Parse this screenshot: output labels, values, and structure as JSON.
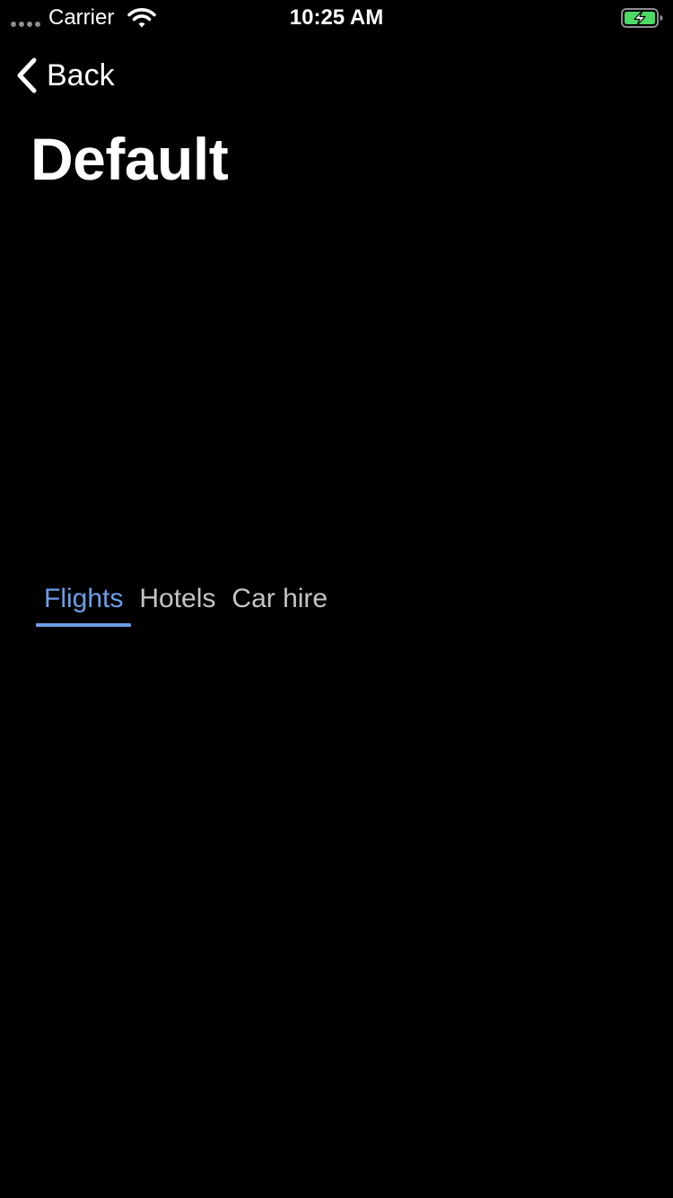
{
  "status_bar": {
    "carrier": "Carrier",
    "time": "10:25 AM",
    "signal_icon": "signal-dots-icon",
    "wifi_icon": "wifi-icon",
    "battery_icon": "battery-charging-icon",
    "battery_color": "#4cd964"
  },
  "nav": {
    "back_label": "Back",
    "back_icon": "chevron-left-icon"
  },
  "page": {
    "title": "Default"
  },
  "tabs": {
    "accent_color": "#6d9ee8",
    "inactive_color": "#c4c4c6",
    "selected": "Flights",
    "items": [
      {
        "label": "Flights"
      },
      {
        "label": "Hotels"
      },
      {
        "label": "Car hire"
      }
    ]
  }
}
